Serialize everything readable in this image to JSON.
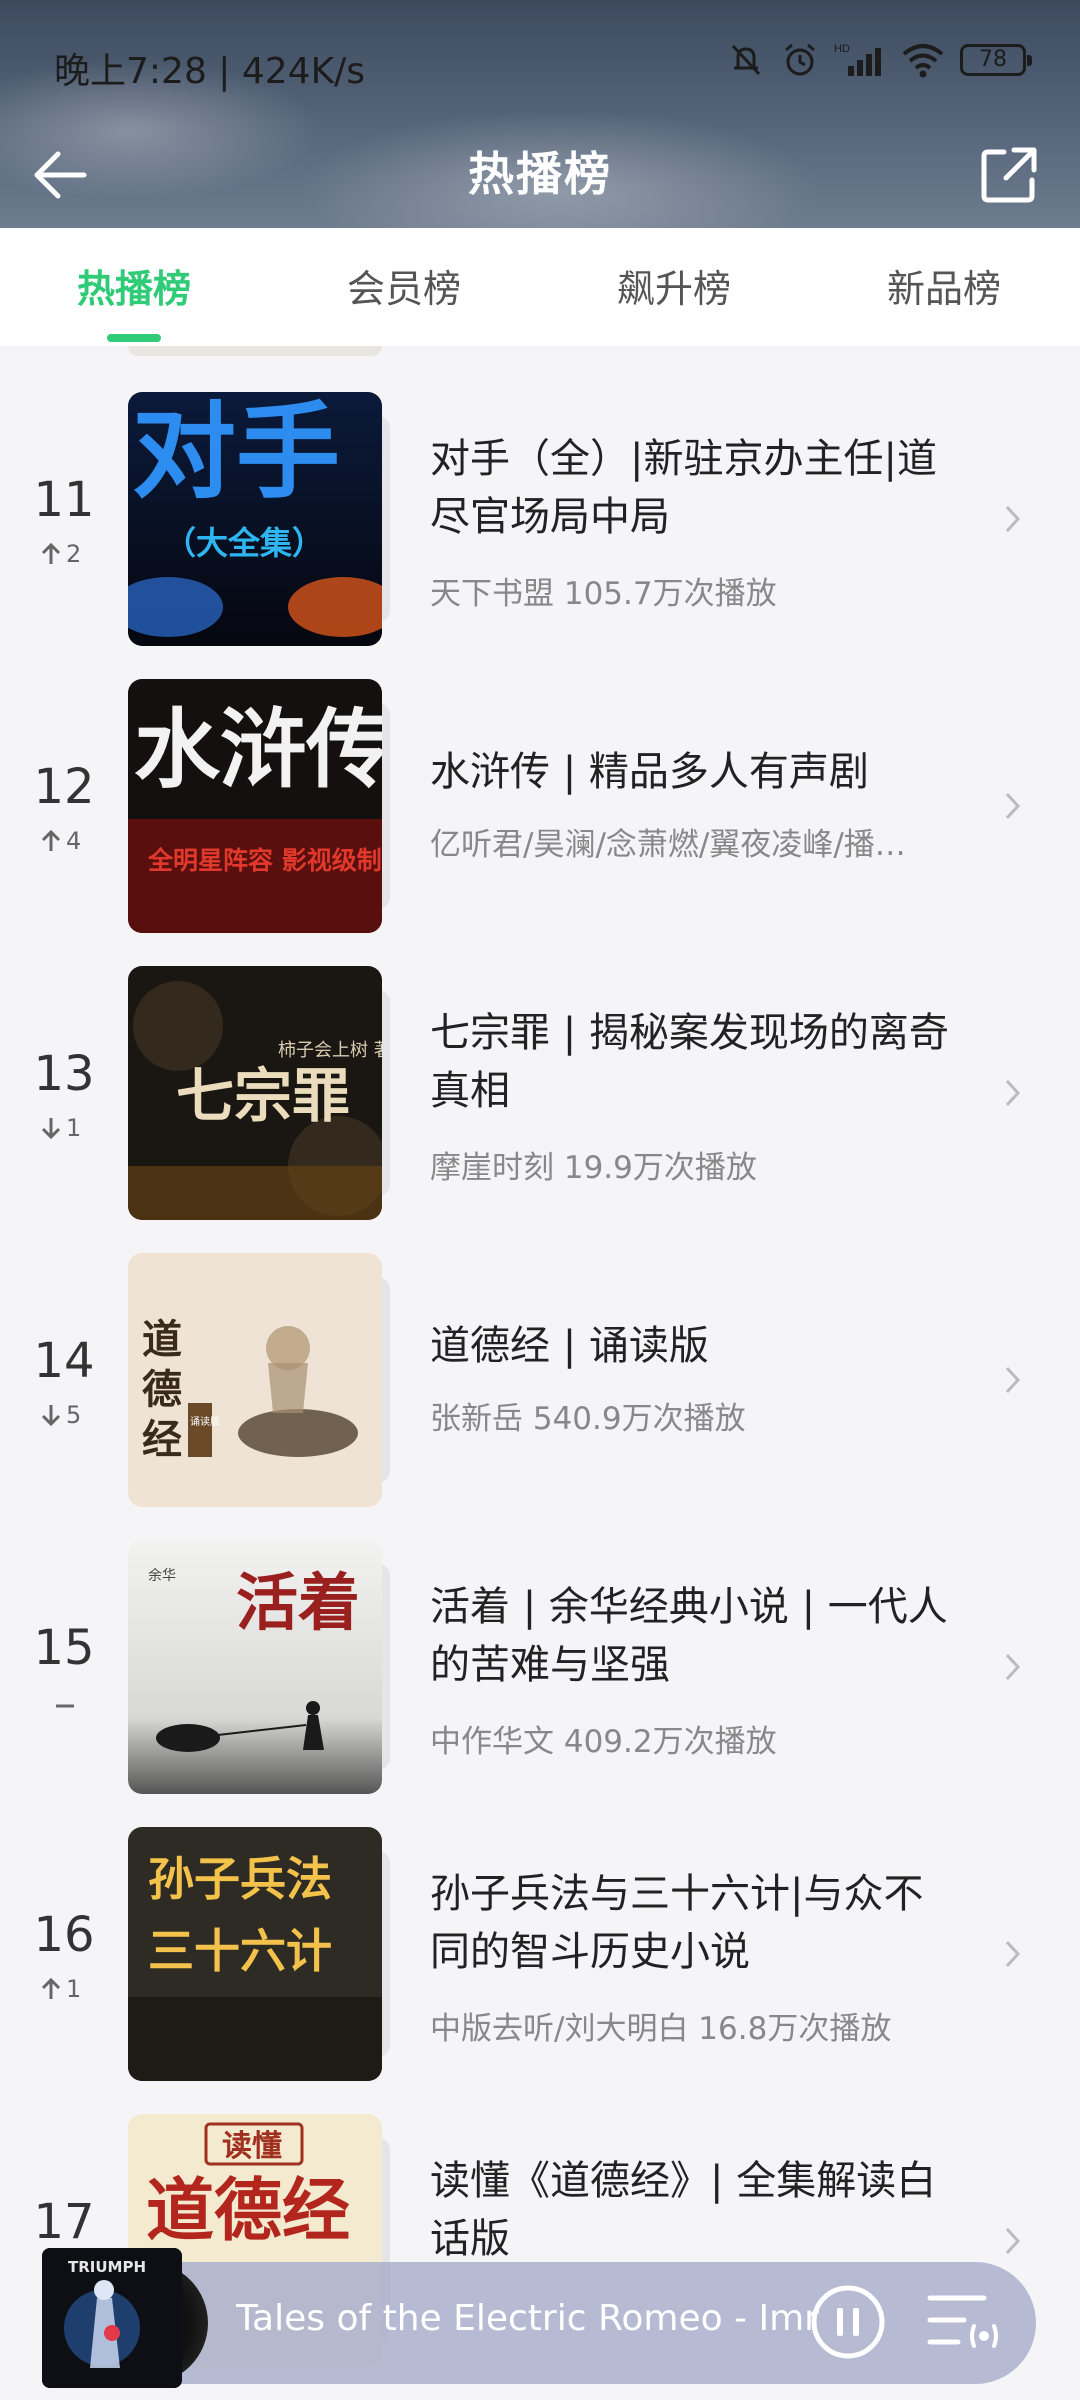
{
  "status_bar": {
    "time": "晚上7:28 | 424K/s",
    "battery": "78"
  },
  "header": {
    "title": "热播榜",
    "back_icon": "back-arrow-icon",
    "share_icon": "share-icon"
  },
  "tabs": [
    {
      "label": "热播榜",
      "active": true
    },
    {
      "label": "会员榜",
      "active": false
    },
    {
      "label": "飙升榜",
      "active": false
    },
    {
      "label": "新品榜",
      "active": false
    }
  ],
  "items": [
    {
      "rank": "11",
      "trend": "up",
      "delta": "2",
      "title": "对手（全）|新驻京办主任|道尽官场局中局",
      "meta": "天下书盟  105.7万次播放",
      "cover_text": "对手",
      "cover_sub": "（大全集）"
    },
    {
      "rank": "12",
      "trend": "up",
      "delta": "4",
      "title": "水浒传 | 精品多人有声剧",
      "meta": "亿听君/昊澜/念萧燃/翼夜凌峰/播…",
      "cover_text": "水浒传",
      "cover_sub": "全明星阵容 影视级制作"
    },
    {
      "rank": "13",
      "trend": "down",
      "delta": "1",
      "title": "七宗罪 | 揭秘案发现场的离奇真相",
      "meta": "摩崖时刻  19.9万次播放",
      "cover_text": "七宗罪",
      "cover_sub": "柿子会上树 著"
    },
    {
      "rank": "14",
      "trend": "down",
      "delta": "5",
      "title": "道德经 | 诵读版",
      "meta": "张新岳  540.9万次播放",
      "cover_text": "道德经",
      "cover_sub": "诵读版"
    },
    {
      "rank": "15",
      "trend": "flat",
      "delta": "",
      "title": "活着 | 余华经典小说 | 一代人的苦难与坚强",
      "meta": "中作华文  409.2万次播放",
      "cover_text": "活着",
      "cover_sub": "余华"
    },
    {
      "rank": "16",
      "trend": "up",
      "delta": "1",
      "title": "孙子兵法与三十六计|与众不同的智斗历史小说",
      "meta": "中版去听/刘大明白  16.8万次播放",
      "cover_text": "孙子兵法",
      "cover_sub": "三十六计"
    },
    {
      "rank": "17",
      "trend": "none",
      "delta": "",
      "title": "读懂《道德经》| 全集解读白话版",
      "meta": "",
      "cover_text": "道德经",
      "cover_sub": "读懂"
    }
  ],
  "player": {
    "track": "Tales of the Electric Romeo - Imr",
    "art_text": "TRIUMPH"
  },
  "colors": {
    "accent": "#2fcb76",
    "header_bg": "#4a5870"
  }
}
